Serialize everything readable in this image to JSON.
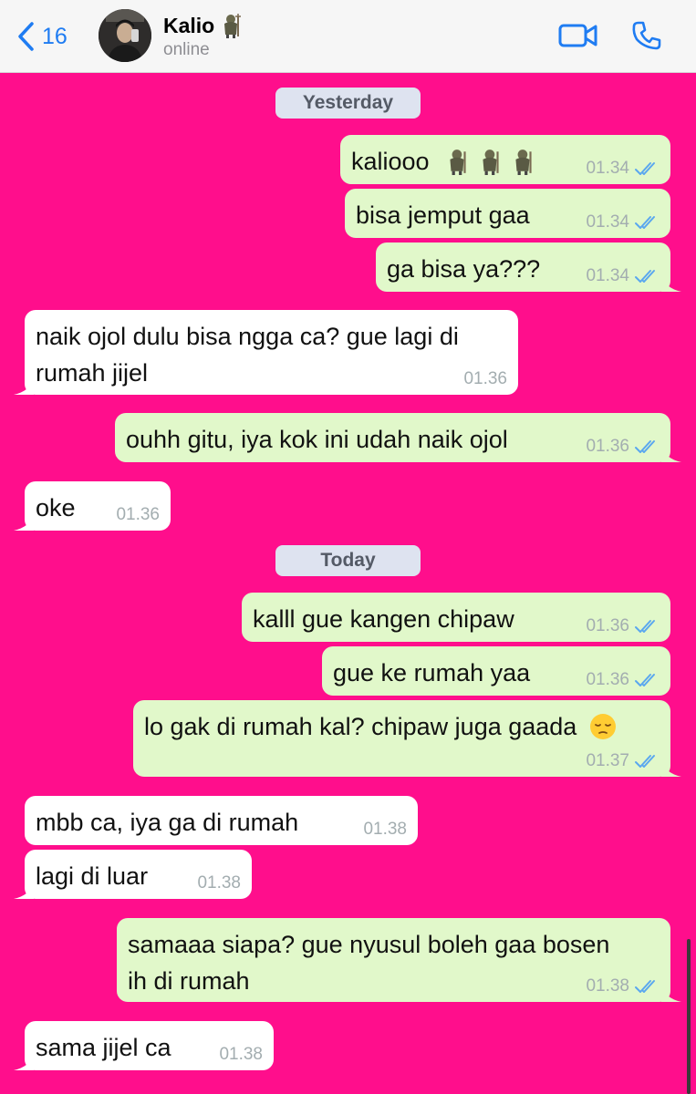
{
  "header": {
    "back_count": "16",
    "contact_name": "Kalio",
    "status": "online",
    "name_emoji": "troll-emoji",
    "icons": [
      "back-chevron-icon",
      "video-call-icon",
      "phone-call-icon"
    ]
  },
  "days": [
    "Yesterday",
    "Today"
  ],
  "messages": [
    {
      "text": "kaliooo",
      "time": "01.34",
      "dir": "out"
    },
    {
      "text": "bisa jemput gaa",
      "time": "01.34",
      "dir": "out"
    },
    {
      "text": "ga bisa ya???",
      "time": "01.34",
      "dir": "out"
    },
    {
      "text": "naik ojol dulu bisa ngga ca? gue lagi di\nrumah jijel",
      "time": "01.36",
      "dir": "in"
    },
    {
      "text": "ouhh gitu, iya kok ini udah naik ojol",
      "time": "01.36",
      "dir": "out"
    },
    {
      "text": "oke",
      "time": "01.36",
      "dir": "in"
    },
    {
      "text": "kalll gue kangen chipaw",
      "time": "01.36",
      "dir": "out"
    },
    {
      "text": "gue ke rumah yaa",
      "time": "01.36",
      "dir": "out"
    },
    {
      "text": "lo gak di rumah kal? chipaw juga gaada",
      "time": "01.37",
      "dir": "out"
    },
    {
      "text": "mbb ca, iya ga di rumah",
      "time": "01.38",
      "dir": "in"
    },
    {
      "text": "lagi di luar",
      "time": "01.38",
      "dir": "in"
    },
    {
      "text": "samaaa siapa? gue nyusul boleh gaa bosen\nih di rumah",
      "time": "01.38",
      "dir": "out"
    },
    {
      "text": "sama jijel ca",
      "time": "01.38",
      "dir": "in"
    }
  ],
  "colors": {
    "background": "#ff0e8c",
    "outgoing_bubble": "#e1f8ca",
    "incoming_bubble": "#ffffff",
    "accent": "#1f7cf2",
    "read_ticks": "#5aa7ef"
  }
}
